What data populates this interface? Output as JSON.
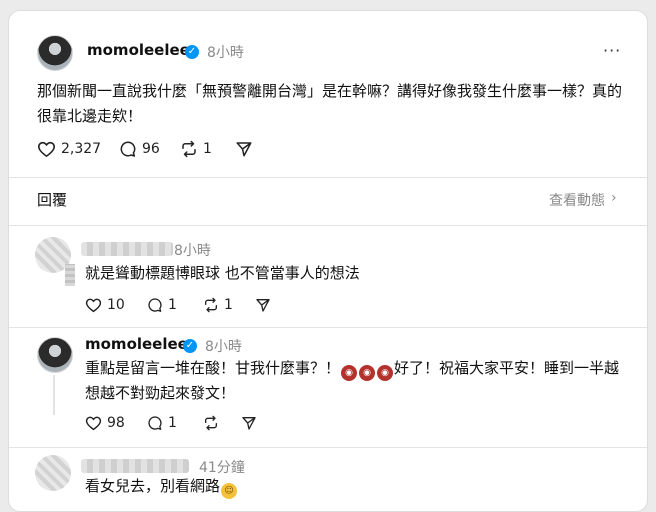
{
  "post": {
    "username": "momoleelee",
    "time": "8小時",
    "text_line1": "那個新聞一直說我什麼「無預警離開台灣」是在幹嘛？講得好像我發生什麼事一樣？真的",
    "text_line2": "很靠北邊走欸！",
    "likes": "2,327",
    "comments": "96",
    "reposts": "1"
  },
  "replies_header": {
    "label": "回覆",
    "view_activity": "查看動態",
    "chevron": "›"
  },
  "comment1": {
    "time": "8小時",
    "text": "就是聳動標題博眼球 也不管當事人的想法",
    "likes": "10",
    "comments": "1",
    "reposts": "1"
  },
  "comment2": {
    "username": "momoleelee",
    "time": "8小時",
    "text_a": "重點是留言一堆在酸！甘我什麼事？！",
    "text_b": "好了！祝福大家平安！睡到一半越",
    "text_line2": "想越不對勁起來發文！",
    "likes": "98",
    "comments": "1"
  },
  "comment3": {
    "time": "41分鐘",
    "text": "看女兒去，別看網路"
  },
  "colors": {
    "verified": "#0095f6",
    "muted_text": "#8a8a8a",
    "angry_emoji": "#b3322c"
  },
  "icons": [
    "verified-icon",
    "more-icon",
    "heart-icon",
    "comment-icon",
    "repost-icon",
    "share-icon",
    "chevron-right-icon",
    "angry-emoji-icon",
    "laugh-emoji-icon"
  ]
}
